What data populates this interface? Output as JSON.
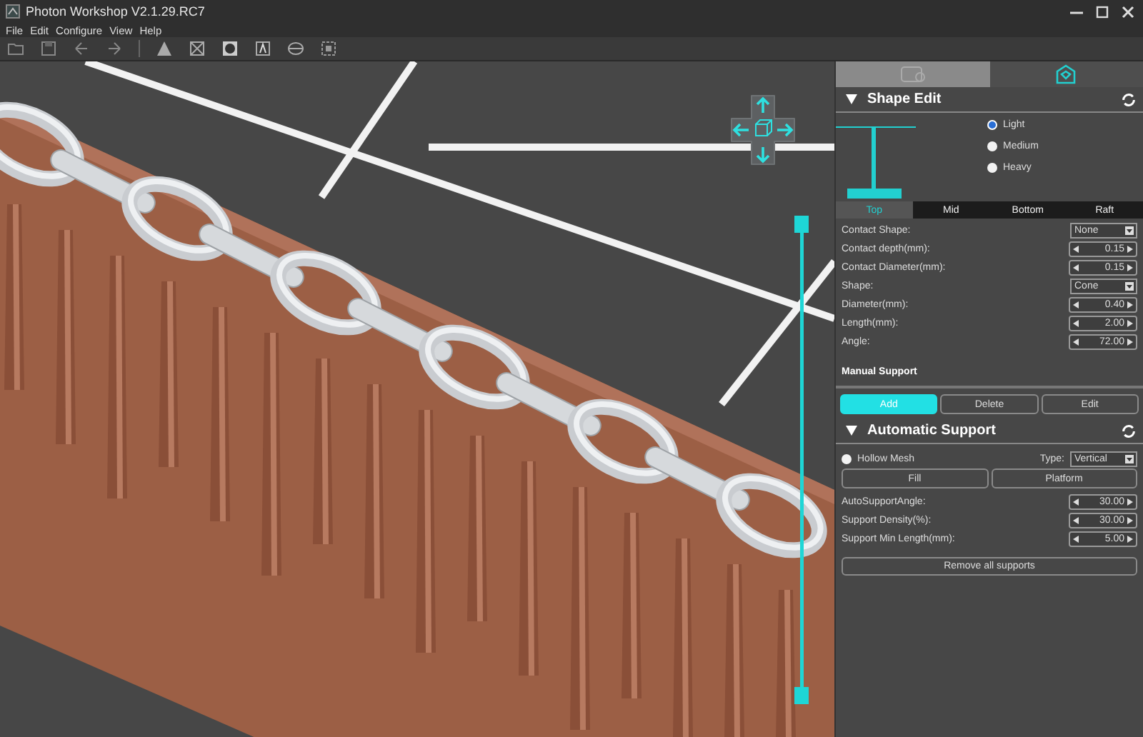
{
  "window": {
    "title": "Photon Workshop V2.1.29.RC7"
  },
  "menu": [
    "File",
    "Edit",
    "Configure",
    "View",
    "Help"
  ],
  "layer_slider": {
    "level": 1
  },
  "panel_tabs": [
    {
      "selected": false
    },
    {
      "selected": true
    }
  ],
  "shape_edit": {
    "title": "Shape Edit",
    "weights": [
      {
        "label": "Light",
        "selected": true
      },
      {
        "label": "Medium",
        "selected": false
      },
      {
        "label": "Heavy",
        "selected": false
      }
    ],
    "tabs": [
      {
        "label": "Top",
        "selected": true
      },
      {
        "label": "Mid",
        "selected": false
      },
      {
        "label": "Bottom",
        "selected": false
      },
      {
        "label": "Raft",
        "selected": false
      }
    ],
    "fields": [
      {
        "label": "Contact Shape:",
        "kind": "dropdown",
        "value": "None"
      },
      {
        "label": "Contact depth(mm):",
        "kind": "spin",
        "value": "0.15"
      },
      {
        "label": "Contact Diameter(mm):",
        "kind": "spin",
        "value": "0.15"
      },
      {
        "label": "Shape:",
        "kind": "dropdown",
        "value": "Cone"
      },
      {
        "label": "Diameter(mm):",
        "kind": "spin",
        "value": "0.40"
      },
      {
        "label": "Length(mm):",
        "kind": "spin",
        "value": "2.00"
      },
      {
        "label": "Angle:",
        "kind": "spin",
        "value": "72.00"
      }
    ]
  },
  "manual_support": {
    "title": "Manual Support",
    "buttons": [
      {
        "label": "Add",
        "selected": true
      },
      {
        "label": "Delete",
        "selected": false
      },
      {
        "label": "Edit",
        "selected": false
      }
    ]
  },
  "automatic_support": {
    "title": "Automatic Support",
    "hollow_mesh": {
      "label": "Hollow Mesh",
      "checked": false
    },
    "type": {
      "label": "Type:",
      "value": "Vertical"
    },
    "buttons": [
      "Fill",
      "Platform"
    ],
    "fields": [
      {
        "label": "AutoSupportAngle:",
        "kind": "spin",
        "value": "30.00"
      },
      {
        "label": "Support Density(%):",
        "kind": "spin",
        "value": "30.00"
      },
      {
        "label": "Support Min Length(mm):",
        "kind": "spin",
        "value": "5.00"
      }
    ],
    "remove_button": "Remove all supports"
  }
}
